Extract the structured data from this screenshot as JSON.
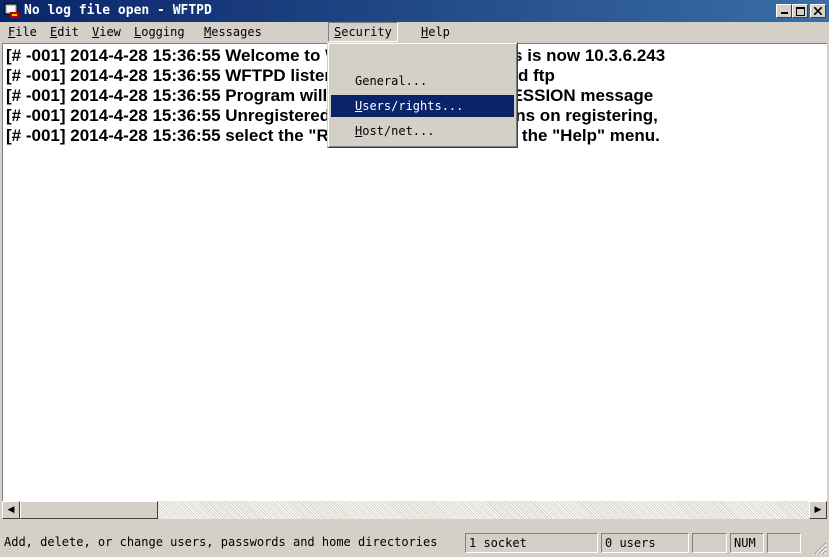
{
  "window": {
    "title": "No log file open - WFTPD"
  },
  "menubar": {
    "items": [
      {
        "label_u": "F",
        "label_rest": "ile"
      },
      {
        "label_u": "E",
        "label_rest": "dit"
      },
      {
        "label_u": "V",
        "label_rest": "iew"
      },
      {
        "label_u": "L",
        "label_rest": "ogging"
      },
      {
        "label_u": "M",
        "label_rest": "essages"
      },
      {
        "label_u": "S",
        "label_rest": "ecurity"
      },
      {
        "label_u": "H",
        "label_rest": "elp"
      }
    ]
  },
  "security_menu": {
    "items": [
      {
        "label": "General..."
      },
      {
        "label_u": "U",
        "label_rest": "sers/rights..."
      },
      {
        "label_u": "H",
        "label_rest": "ost/net..."
      }
    ]
  },
  "log": {
    "lines": [
      "[# -001] 2014-4-28 15:36:55 Welcome to WFTPD. Your IP address is now 10.3.6.243",
      "[# -001] 2014-4-28 15:36:55 WFTPD listening on port 21, standard ftp",
      "[# -001] 2014-4-28 15:36:55 Program will respond to WM_ENDSESSION message",
      "[# -001] 2014-4-28 15:36:55 Unregistered version - for instructions on registering,",
      "[# -001] 2014-4-28 15:36:55 select the \"Registering\" option from the \"Help\" menu."
    ]
  },
  "statusbar": {
    "message": "Add, delete, or change users, passwords and home directories",
    "sockets": "1 socket",
    "users": "0 users",
    "num": "NUM"
  },
  "colors": {
    "title_active": "#0a246a",
    "highlight": "#0a246a",
    "face": "#d4d0c8"
  }
}
